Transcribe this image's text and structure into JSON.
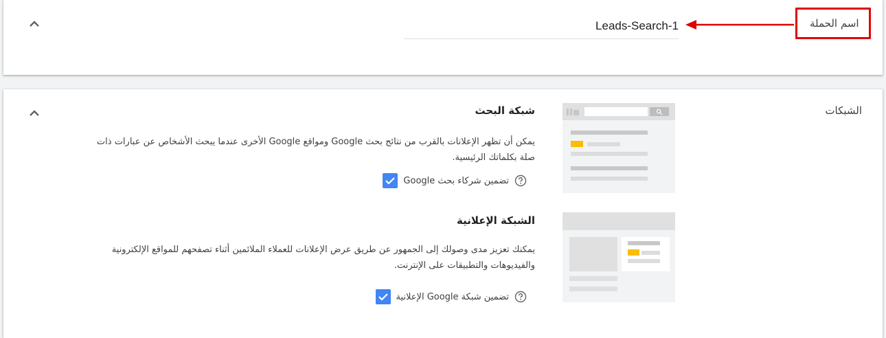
{
  "campaign_name": {
    "label": "اسم الحملة",
    "value": "Leads-Search-1"
  },
  "networks": {
    "label": "الشبكات",
    "search": {
      "title": "شبكة البحث",
      "description": "يمكن أن تظهر الإعلانات بالقرب من نتائج بحث Google ومواقع Google الأخرى عندما يبحث الأشخاص عن عبارات ذات صلة بكلماتك الرئيسية.",
      "checkbox_label": "تضمين شركاء بحث Google",
      "checked": true
    },
    "display": {
      "title": "الشبكة الإعلانية",
      "description": "يمكنك تعزيز مدى وصولك إلى الجمهور عن طريق عرض الإعلانات للعملاء الملائمين أثناء تصفحهم للمواقع الإلكترونية والفيديوهات والتطبيقات على الإنترنت.",
      "checkbox_label": "تضمين شبكة Google الإعلانية",
      "checked": true
    }
  },
  "colors": {
    "accent": "#4285f4",
    "annotation": "#e00000",
    "highlight": "#fbbc04"
  },
  "icons": [
    "chevron-up-icon",
    "checkmark-icon",
    "help-icon",
    "search-icon",
    "arrow-icon"
  ]
}
